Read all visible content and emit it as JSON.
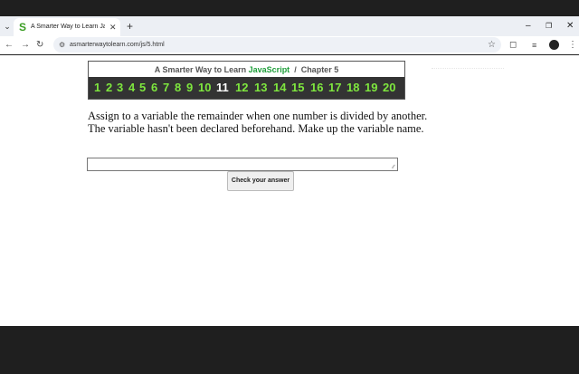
{
  "browser": {
    "tab": {
      "favicon": "S",
      "title": "A Smarter Way to Learn JavaScr"
    },
    "new_tab": "+",
    "url": "asmarterwaytolearn.com/js/5.html"
  },
  "page": {
    "banner": {
      "title_prefix": "A Smarter Way to Learn ",
      "title_js": "JavaScript",
      "title_suffix": "  /  Chapter 5"
    },
    "chapters": [
      "1",
      "2",
      "3",
      "4",
      "5",
      "6",
      "7",
      "8",
      "9",
      "10",
      "11",
      "12",
      "13",
      "14",
      "15",
      "16",
      "17",
      "18",
      "19",
      "20"
    ],
    "current_chapter": "11",
    "instructions": "Assign to a variable the remainder when one number is divided by another. The variable hasn't been declared beforehand. Make up the variable name.",
    "answer_value": "",
    "check_button": "Check your answer"
  },
  "colors": {
    "chapter_link": "#7ee63e",
    "current_chapter": "#ffffff",
    "javascript_word": "#1e9e3a"
  }
}
